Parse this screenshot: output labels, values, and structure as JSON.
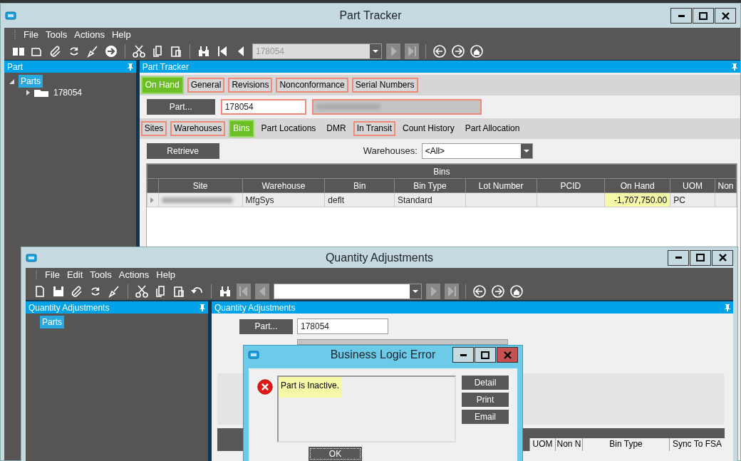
{
  "part_tracker": {
    "title": "Part Tracker",
    "menu": [
      "File",
      "Tools",
      "Actions",
      "Help"
    ],
    "nav_combo": {
      "value": "178054",
      "disabled": true
    },
    "side_panel": {
      "title": "Part",
      "tree": [
        {
          "label": "Parts",
          "selected": true,
          "expanded": true,
          "children": [
            {
              "label": "178054",
              "selected": false,
              "expanded": false
            }
          ]
        }
      ]
    },
    "main_panel_title": "Part Tracker",
    "tabs": [
      {
        "label": "On Hand",
        "selected": true,
        "outlined": false
      },
      {
        "label": "General",
        "selected": false,
        "outlined": true
      },
      {
        "label": "Revisions",
        "selected": false,
        "outlined": true
      },
      {
        "label": "Nonconformance",
        "selected": false,
        "outlined": true
      },
      {
        "label": "Serial Numbers",
        "selected": false,
        "outlined": true
      }
    ],
    "part_button": "Part...",
    "part_field": {
      "value": "178054",
      "outlined": true
    },
    "description_field": {
      "kind": "blurred",
      "outlined": true
    },
    "sub_tabs": [
      {
        "label": "Sites",
        "selected": false,
        "outlined": true
      },
      {
        "label": "Warehouses",
        "selected": false,
        "outlined": true
      },
      {
        "label": "Bins",
        "selected": true,
        "outlined": false
      },
      {
        "label": "Part Locations",
        "selected": false,
        "outlined": false
      },
      {
        "label": "DMR",
        "selected": false,
        "outlined": false
      },
      {
        "label": "In Transit",
        "selected": false,
        "outlined": true
      },
      {
        "label": "Count History",
        "selected": false,
        "outlined": false
      },
      {
        "label": "Part Allocation",
        "selected": false,
        "outlined": false
      }
    ],
    "retrieve_button": "Retrieve",
    "warehouse_filter": {
      "label": "Warehouses:",
      "value": "<All>"
    },
    "grid": {
      "title": "Bins",
      "columns": [
        "Site",
        "Warehouse",
        "Bin",
        "Bin Type",
        "Lot Number",
        "PCID",
        "On Hand",
        "UOM",
        "Non"
      ],
      "rows": [
        {
          "cells": [
            {
              "kind": "blurred"
            },
            {
              "kind": "text",
              "text": "MfgSys",
              "highlighted": false
            },
            {
              "kind": "text",
              "text": "deflt",
              "highlighted": false
            },
            {
              "kind": "text",
              "text": "Standard",
              "highlighted": false
            },
            {
              "kind": "empty"
            },
            {
              "kind": "empty"
            },
            {
              "kind": "number",
              "text": "-1,707,750.00",
              "highlighted": true
            },
            {
              "kind": "text",
              "text": "PC",
              "highlighted": false
            },
            {
              "kind": "empty"
            }
          ]
        }
      ]
    }
  },
  "quantity_adjustments": {
    "title": "Quantity Adjustments",
    "menu": [
      "File",
      "Edit",
      "Tools",
      "Actions",
      "Help"
    ],
    "side_panel": {
      "title": "Quantity Adjustments",
      "tree": [
        {
          "label": "Parts",
          "selected": true
        }
      ]
    },
    "main_panel_title": "Quantity Adjustments",
    "part_button": "Part...",
    "part_field": {
      "value": "178054"
    },
    "grid_columns": [
      "UOM",
      "Non N",
      "Bin Type",
      "Sync To FSA"
    ]
  },
  "error_dialog": {
    "title": "Business Logic Error",
    "message": {
      "text": "Part is Inactive.",
      "highlighted": true
    },
    "buttons": [
      "Detail",
      "Print",
      "Email"
    ],
    "ok_button": "OK"
  }
}
